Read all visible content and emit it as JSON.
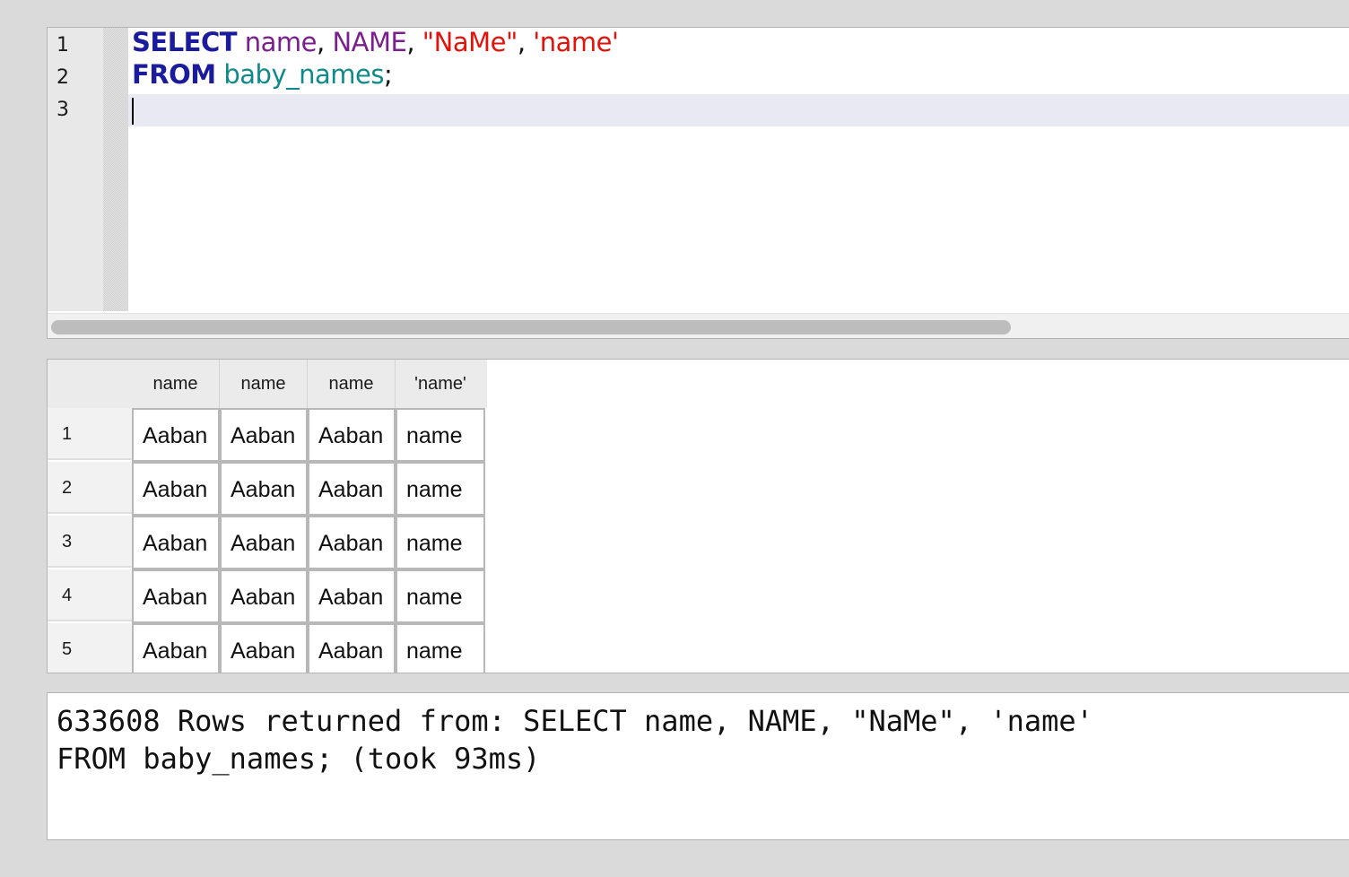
{
  "editor": {
    "line_numbers": [
      "1",
      "2",
      "3"
    ],
    "line1": {
      "kw_select": "SELECT",
      "id_name": "name",
      "comma1": ",",
      "id_NAME": "NAME",
      "comma2": ",",
      "str_dq": "\"NaMe\"",
      "comma3": ",",
      "str_sq": "'name'"
    },
    "line2": {
      "kw_from": "FROM",
      "table": "baby_names",
      "semicolon": ";"
    }
  },
  "results": {
    "columns": [
      "name",
      "name",
      "name",
      "'name'"
    ],
    "rows": [
      {
        "num": "1",
        "cells": [
          "Aaban",
          "Aaban",
          "Aaban",
          "name"
        ]
      },
      {
        "num": "2",
        "cells": [
          "Aaban",
          "Aaban",
          "Aaban",
          "name"
        ]
      },
      {
        "num": "3",
        "cells": [
          "Aaban",
          "Aaban",
          "Aaban",
          "name"
        ]
      },
      {
        "num": "4",
        "cells": [
          "Aaban",
          "Aaban",
          "Aaban",
          "name"
        ]
      },
      {
        "num": "5",
        "cells": [
          "Aaban",
          "Aaban",
          "Aaban",
          "name"
        ]
      }
    ]
  },
  "message": {
    "line1": "633608 Rows returned from: SELECT name, NAME, \"NaMe\", 'name'",
    "line2": "FROM baby_names; (took 93ms)"
  },
  "colors": {
    "keyword": "#1b1b9e",
    "identifier": "#7a1f8e",
    "table": "#0f8a8a",
    "string": "#e3120b",
    "current_line": "#e9e9f4"
  }
}
